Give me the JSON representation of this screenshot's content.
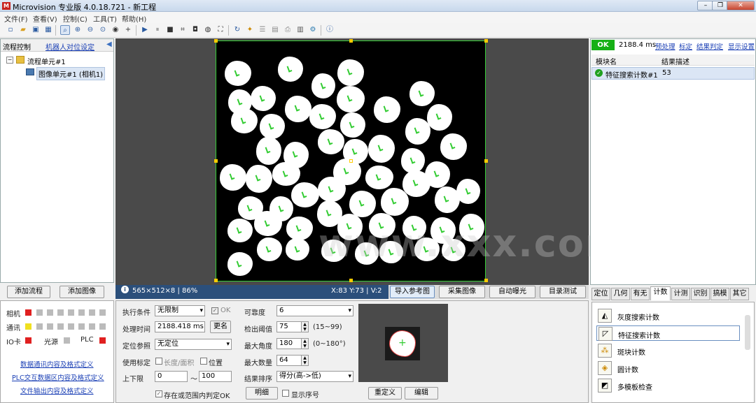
{
  "window": {
    "title": "Microvision 专业版 4.0.18.721 - 新工程",
    "logo": "M"
  },
  "menu": [
    "文件(F)",
    "查看(V)",
    "控制(C)",
    "工具(T)",
    "帮助(H)"
  ],
  "toolbar_icons": [
    "new-file-icon",
    "open-folder-icon",
    "save-icon",
    "grid-icon",
    "zoom-fit-icon",
    "zoom-in-icon",
    "zoom-out-icon",
    "zoom-reset-icon",
    "eye-icon",
    "crosshair-icon",
    "run-once-icon",
    "pause-icon",
    "stop-icon",
    "crop-icon",
    "camera-icon",
    "color-icon",
    "fullscreen-icon",
    "refresh-icon",
    "tools-icon",
    "list-icon",
    "image-icon",
    "print-icon",
    "settings-icon",
    "info-icon"
  ],
  "left_panel": {
    "header": "流程控制",
    "link": "机器人对位设定",
    "tree_root": "流程单元#1",
    "tree_child": "图像单元#1 (相机1)"
  },
  "left_buttons": {
    "add_flow": "添加流程",
    "add_image": "添加图像"
  },
  "indicators": {
    "camera": "相机",
    "comm": "通讯",
    "io": "IO卡",
    "light": "光源",
    "plc": "PLC",
    "camera_color": "#e02020",
    "comm_color": "#f0e020",
    "io_color": "#e02020",
    "plc_color": "#e02020"
  },
  "left_links": [
    "数据通讯内容及格式定义",
    "PLC交互数据区内容及格式定义",
    "文件输出内容及格式定义"
  ],
  "status": {
    "info": "565×512×8 | 86%",
    "coords": "X:83 Y:73 | V:2"
  },
  "status_buttons": [
    "导入参考图",
    "采集图像",
    "自动曝光",
    "目录测试"
  ],
  "params": {
    "exec_cond_label": "执行条件",
    "exec_cond_value": "无限制",
    "ok_label": "OK",
    "proc_time_label": "处理时间",
    "proc_time_value": "2188.418 ms",
    "rename": "更名",
    "locate_label": "定位参照",
    "locate_value": "无定位",
    "calib_label": "使用标定",
    "length_area": "长度/面积",
    "position": "位置",
    "limit_label": "上下限",
    "limit_low": "0",
    "tilde": "～",
    "limit_high": "100",
    "in_range_ok": "存在或范围内判定OK",
    "reliability_label": "可靠度",
    "reliability_value": "6",
    "threshold_label": "检出阈值",
    "threshold_value": "75",
    "threshold_range": "(15~99)",
    "max_angle_label": "最大角度",
    "max_angle_value": "180",
    "max_angle_range": "(0~180°)",
    "max_count_label": "最大数量",
    "max_count_value": "64",
    "sort_label": "结果排序",
    "sort_value": "得分(高->低)",
    "detail": "明细",
    "show_index": "显示序号",
    "redefine": "重定义",
    "edit": "编辑"
  },
  "right_panel": {
    "ok_badge": "OK",
    "time": "2188.4 ms",
    "links": [
      "预处理",
      "标定",
      "结果判定",
      "显示设置"
    ],
    "col_module": "模块名",
    "col_result": "结果描述",
    "row_name": "特征搜索计数#1",
    "row_result": "53"
  },
  "tabs": [
    "定位",
    "几何",
    "有无",
    "计数",
    "计测",
    "识别",
    "搞模",
    "其它"
  ],
  "active_tab": "计数",
  "tools": [
    "灰度搜索计数",
    "特征搜索计数",
    "斑块计数",
    "圆计数",
    "多模板检查"
  ],
  "selected_tool": "特征搜索计数",
  "watermark": "www.xxx.com"
}
